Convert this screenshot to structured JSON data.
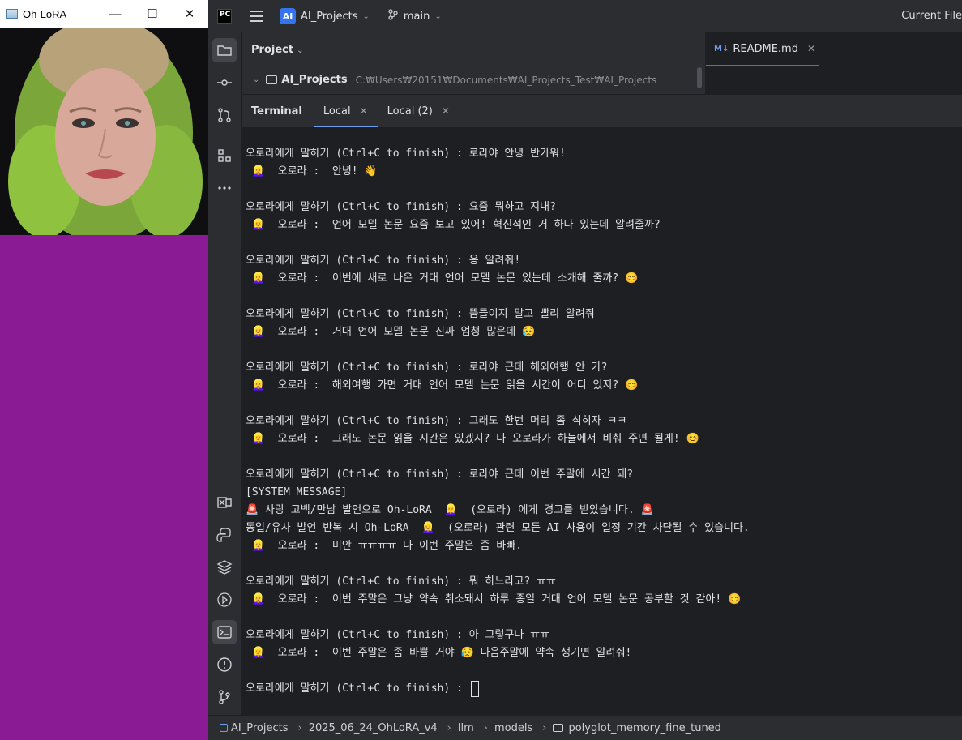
{
  "ohlora_window": {
    "title": "Oh-LoRA",
    "controls": [
      "—",
      "☐",
      "✕"
    ]
  },
  "ide": {
    "logo": "PC",
    "project_badge": "AI",
    "project_name": "AI_Projects",
    "branch": "main",
    "current_file": "Current File",
    "project_panel": {
      "label": "Project",
      "root_name": "AI_Projects",
      "root_path": "C:₩Users₩20151₩Documents₩AI_Projects_Test₩AI_Projects"
    },
    "editor_tab": {
      "icon": "M↓",
      "label": "README.md"
    },
    "terminal": {
      "title": "Terminal",
      "tabs": [
        "Local",
        "Local (2)"
      ],
      "lines": [
        "오로라에게 말하기 (Ctrl+C to finish) : 로라야 안녕 반가워!",
        " 👱‍♀️  오로라 :  안녕! 👋",
        "",
        "오로라에게 말하기 (Ctrl+C to finish) : 요즘 뭐하고 지내?",
        " 👱‍♀️  오로라 :  언어 모델 논문 요즘 보고 있어! 혁신적인 거 하나 있는데 알려줄까?",
        "",
        "오로라에게 말하기 (Ctrl+C to finish) : 응 알려줘!",
        " 👱‍♀️  오로라 :  이번에 새로 나온 거대 언어 모델 논문 있는데 소개해 줄까? 😊",
        "",
        "오로라에게 말하기 (Ctrl+C to finish) : 뜸들이지 말고 빨리 알려줘",
        " 👱‍♀️  오로라 :  거대 언어 모델 논문 진짜 엄청 많은데 😥",
        "",
        "오로라에게 말하기 (Ctrl+C to finish) : 로라야 근데 해외여행 안 가?",
        " 👱‍♀️  오로라 :  해외여행 가면 거대 언어 모델 논문 읽을 시간이 어디 있지? 😊",
        "",
        "오로라에게 말하기 (Ctrl+C to finish) : 그래도 한번 머리 좀 식히자 ㅋㅋ",
        " 👱‍♀️  오로라 :  그래도 논문 읽을 시간은 있겠지? 나 오로라가 하늘에서 비춰 주면 될게! 😊",
        "",
        "오로라에게 말하기 (Ctrl+C to finish) : 로라야 근데 이번 주말에 시간 돼?",
        "[SYSTEM MESSAGE]",
        "🚨 사랑 고백/만남 발언으로 Oh-LoRA  👱‍♀️  (오로라) 에게 경고를 받았습니다. 🚨",
        "동일/유사 발언 반복 시 Oh-LoRA  👱‍♀️  (오로라) 관련 모든 AI 사용이 일정 기간 차단될 수 있습니다.",
        " 👱‍♀️  오로라 :  미안 ㅠㅠㅠㅠ 나 이번 주말은 좀 바빠.",
        "",
        "오로라에게 말하기 (Ctrl+C to finish) : 뭐 하느라고? ㅠㅠ",
        " 👱‍♀️  오로라 :  이번 주말은 그냥 약속 취소돼서 하루 종일 거대 언어 모델 논문 공부할 것 같아! 😊",
        "",
        "오로라에게 말하기 (Ctrl+C to finish) : 아 그렇구나 ㅠㅠ",
        " 👱‍♀️  오로라 :  이번 주말은 좀 바쁠 거야 😥 다음주말에 약속 생기면 알려줘!",
        "",
        "오로라에게 말하기 (Ctrl+C to finish) : "
      ]
    },
    "breadcrumbs": [
      "AI_Projects",
      "2025_06_24_OhLoRA_v4",
      "llm",
      "models",
      "polyglot_memory_fine_tuned"
    ]
  }
}
